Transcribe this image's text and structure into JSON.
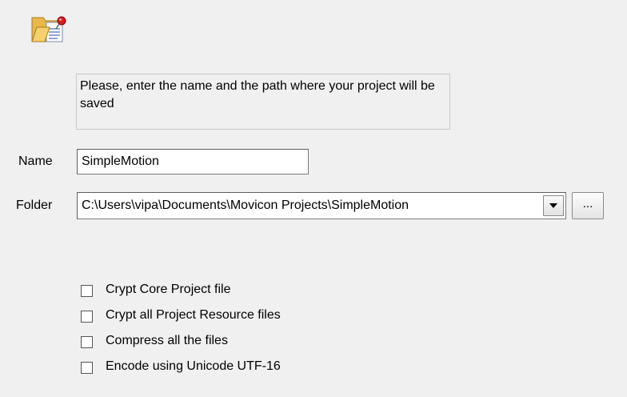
{
  "project_icon": "folder-project-icon",
  "hint": "Please, enter the name and the path where your project will be saved",
  "name": {
    "label": "Name",
    "value": "SimpleMotion"
  },
  "folder": {
    "label": "Folder",
    "value": "C:\\Users\\vipa\\Documents\\Movicon Projects\\SimpleMotion",
    "browse_label": "..."
  },
  "options": [
    {
      "label": "Crypt Core Project file",
      "checked": false
    },
    {
      "label": "Crypt all Project Resource files",
      "checked": false
    },
    {
      "label": "Compress all the files",
      "checked": false
    },
    {
      "label": "Encode using Unicode UTF-16",
      "checked": false
    }
  ]
}
